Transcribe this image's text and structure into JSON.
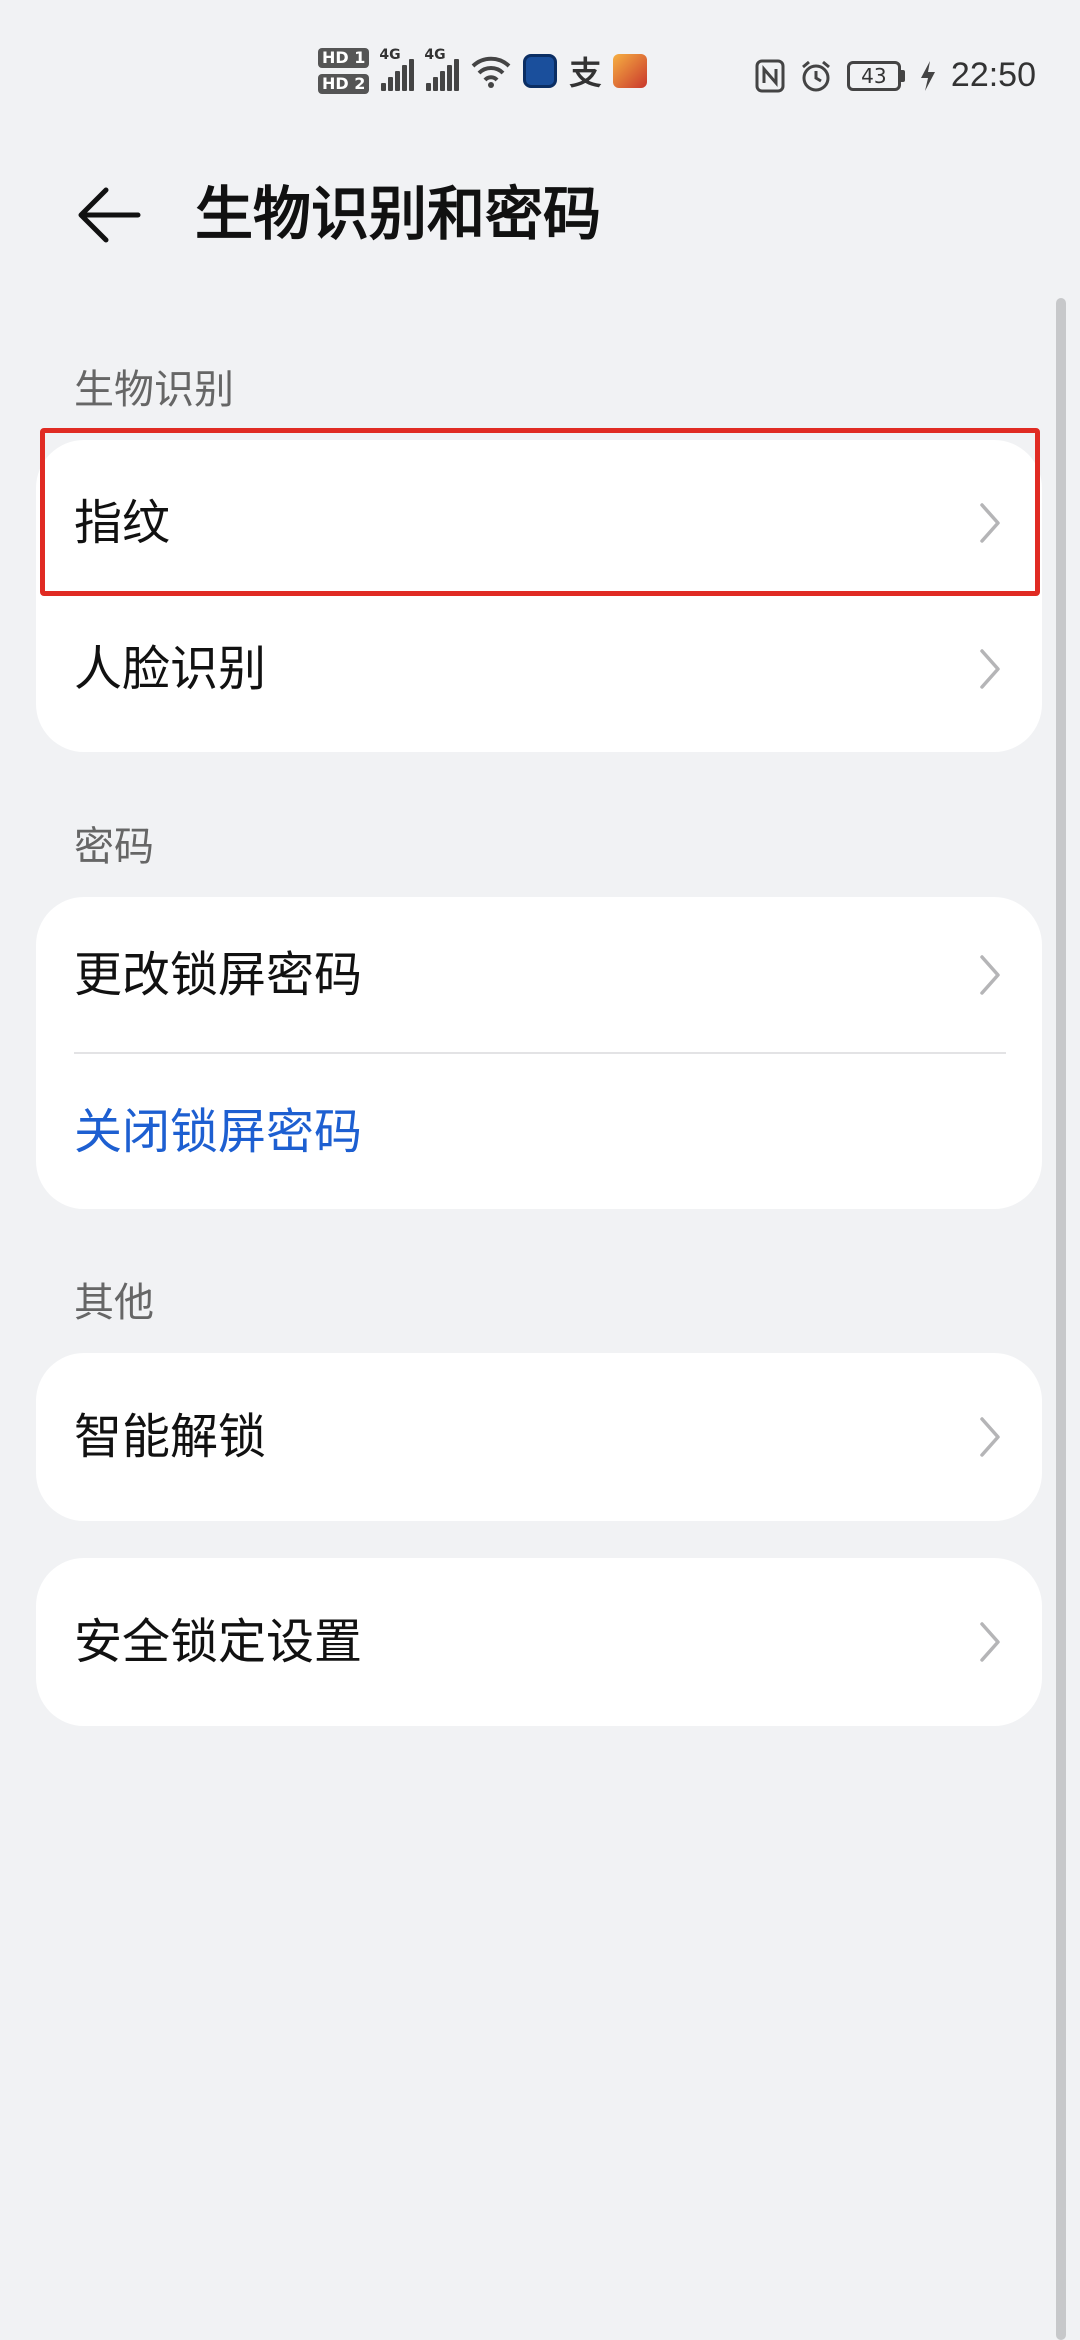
{
  "status_bar": {
    "hd1": "HD 1",
    "hd2": "HD 2",
    "sim1_network": "4G",
    "sim2_network": "4G",
    "battery_level": "43",
    "time": "22:50",
    "icons": [
      "wifi-icon",
      "app-icon",
      "alipay-icon",
      "game-icon",
      "nfc-icon",
      "alarm-icon",
      "battery-icon",
      "charging-icon"
    ]
  },
  "header": {
    "back_icon": "back-arrow-icon",
    "title": "生物识别和密码"
  },
  "sections": {
    "biometrics": {
      "header": "生物识别",
      "items": [
        {
          "label": "指纹"
        },
        {
          "label": "人脸识别"
        }
      ]
    },
    "password": {
      "header": "密码",
      "items": [
        {
          "label": "更改锁屏密码"
        },
        {
          "label": "关闭锁屏密码"
        }
      ]
    },
    "other": {
      "header": "其他",
      "items": [
        {
          "label": "智能解锁"
        }
      ]
    },
    "security_lock": {
      "items": [
        {
          "label": "安全锁定设置"
        }
      ]
    }
  },
  "colors": {
    "background": "#f1f2f4",
    "card": "#ffffff",
    "link": "#1d5fd1",
    "highlight": "#e02b23"
  }
}
